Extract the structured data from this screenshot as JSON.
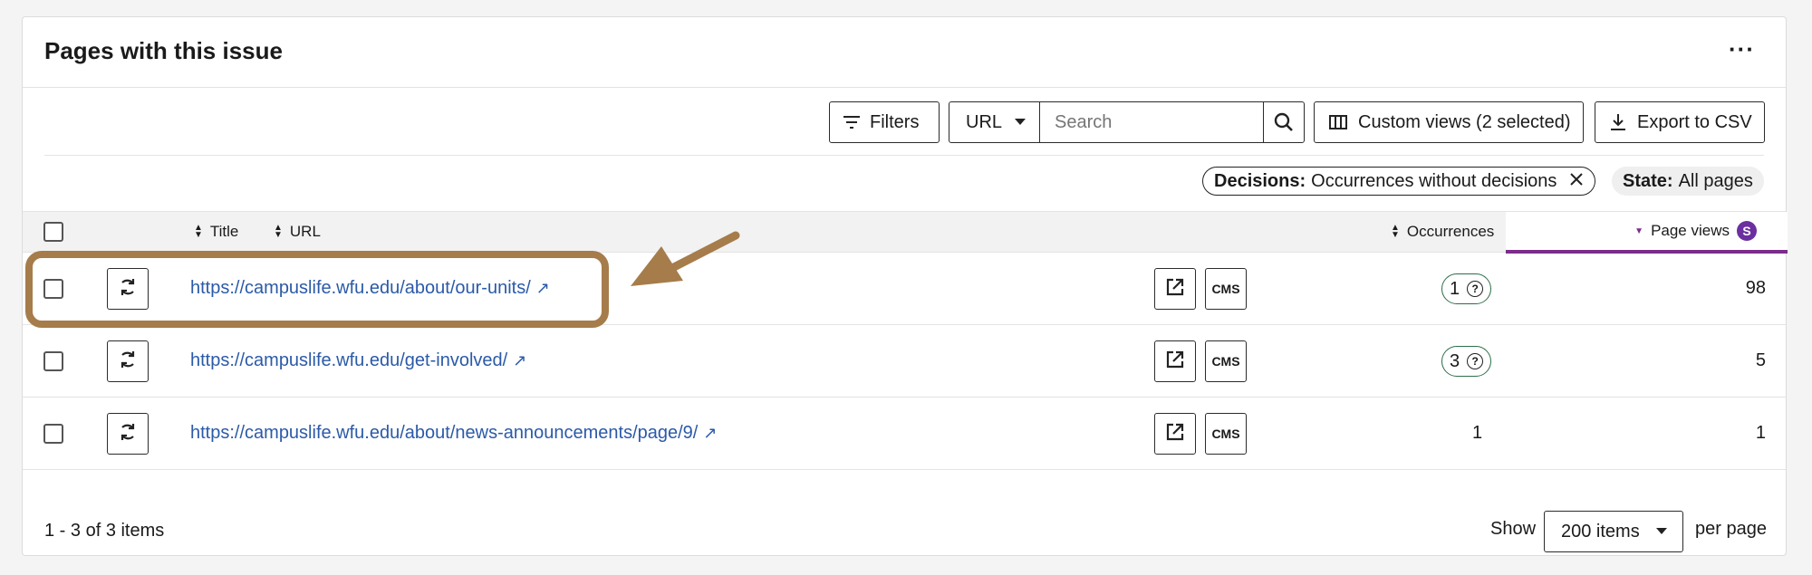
{
  "panel": {
    "title": "Pages with this issue",
    "more_label": "···"
  },
  "toolbar": {
    "filters_label": "Filters",
    "field_select": "URL",
    "search_placeholder": "Search",
    "custom_views_label": "Custom views (2 selected)",
    "export_label": "Export to CSV"
  },
  "chips": {
    "decisions_key": "Decisions:",
    "decisions_value": "Occurrences without decisions",
    "state_key": "State:",
    "state_value": "All pages"
  },
  "columns": {
    "title": "Title",
    "url": "URL",
    "occurrences": "Occurrences",
    "page_views": "Page views",
    "page_views_badge": "S"
  },
  "rows": [
    {
      "url": "https://campuslife.wfu.edu/about/our-units/",
      "occurrences": "1",
      "page_views": "98"
    },
    {
      "url": "https://campuslife.wfu.edu/get-involved/",
      "occurrences": "3",
      "page_views": "5"
    },
    {
      "url": "https://campuslife.wfu.edu/about/news-announcements/page/9/",
      "occurrences": "1",
      "page_views": "1"
    }
  ],
  "row_actions": {
    "cms_label": "CMS",
    "external_glyph": "↗",
    "help_glyph": "?"
  },
  "footer": {
    "range_text": "1 - 3 of 3 items",
    "show_label": "Show",
    "page_size": "200 items",
    "per_page_label": "per page"
  },
  "colors": {
    "link": "#2b5aa8",
    "badge_border": "#2c6e49",
    "sort_accent": "#7b2c8c",
    "annotation": "#a67c4b"
  }
}
